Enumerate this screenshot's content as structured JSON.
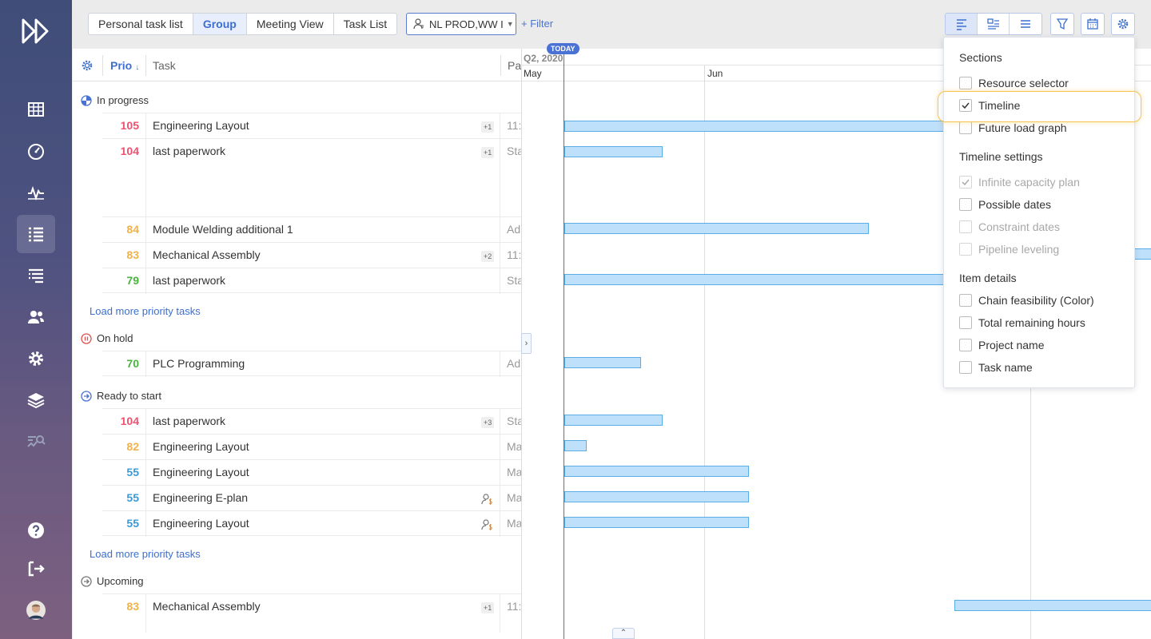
{
  "tabs": [
    "Personal task list",
    "Group",
    "Meeting View",
    "Task List"
  ],
  "resource_select": {
    "value": "NL PROD,WW I"
  },
  "filter_label": "+ Filter",
  "table_header": {
    "prio": "Prio",
    "prio_sort": "↓",
    "task": "Task",
    "pa": "Pa"
  },
  "groups": {
    "in_progress": "In progress",
    "on_hold": "On hold",
    "ready": "Ready to start",
    "upcoming": "Upcoming"
  },
  "rows": [
    {
      "prio": "105",
      "name": "Engineering Layout",
      "badge": "+1",
      "pa": "11:"
    },
    {
      "prio": "104",
      "name": "last paperwork",
      "badge": "+1",
      "pa": "Sta"
    },
    {
      "prio": "84",
      "name": "Module Welding additional 1",
      "pa": "Ad"
    },
    {
      "prio": "83",
      "name": "Mechanical Assembly",
      "badge": "+2",
      "pa": "11:"
    },
    {
      "prio": "79",
      "name": "last paperwork",
      "pa": "Sta"
    },
    {
      "prio": "70",
      "name": "PLC Programming",
      "pa": "Ad"
    },
    {
      "prio": "104",
      "name": "last paperwork",
      "badge": "+3",
      "pa": "Sta"
    },
    {
      "prio": "82",
      "name": "Engineering Layout",
      "pa": "Ma"
    },
    {
      "prio": "55",
      "name": "Engineering Layout",
      "pa": "Ma"
    },
    {
      "prio": "55",
      "name": "Engineering E-plan",
      "icon": "resource-cost-icon",
      "pa": "Ma"
    },
    {
      "prio": "55",
      "name": "Engineering Layout",
      "icon": "resource-cost-icon",
      "pa": "Ma"
    },
    {
      "prio": "83",
      "name": "Mechanical Assembly",
      "badge": "+1",
      "pa": "11:"
    }
  ],
  "load_more": "Load more priority tasks",
  "timeline": {
    "quarter": "Q2, 2020",
    "months": [
      "May",
      "Jun"
    ],
    "today": "TODAY"
  },
  "dropdown": {
    "sections_title": "Sections",
    "timeline_settings_title": "Timeline settings",
    "item_details_title": "Item details",
    "sections": [
      {
        "label": "Resource selector",
        "checked": false
      },
      {
        "label": "Timeline",
        "checked": true
      },
      {
        "label": "Future load graph",
        "checked": false
      }
    ],
    "timeline_settings": [
      {
        "label": "Infinite capacity plan",
        "checked": true,
        "disabled": true
      },
      {
        "label": "Possible dates",
        "checked": false
      },
      {
        "label": "Constraint dates",
        "checked": false,
        "disabled": true
      },
      {
        "label": "Pipeline leveling",
        "checked": false,
        "disabled": true
      }
    ],
    "item_details": [
      {
        "label": "Chain feasibility (Color)",
        "checked": false
      },
      {
        "label": "Total remaining hours",
        "checked": false
      },
      {
        "label": "Project name",
        "checked": false
      },
      {
        "label": "Task name",
        "checked": false
      }
    ]
  },
  "colors": {
    "accent": "#3d6fd0",
    "red": "#ef5170",
    "orange": "#f2b24a",
    "green": "#47b53c",
    "blue": "#3c9ad6",
    "bar_fill": "#bfe0fb",
    "bar_stroke": "#5aaee8",
    "highlight": "#f5c453"
  }
}
